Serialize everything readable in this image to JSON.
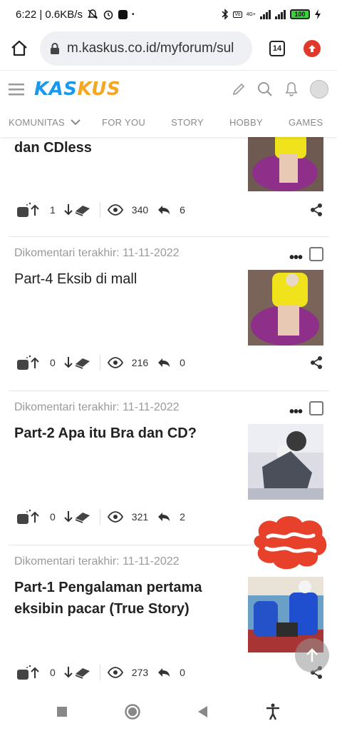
{
  "status": {
    "time_speed": "6:22 | 0.6KB/s",
    "battery": "100",
    "net": "4G+"
  },
  "browser": {
    "url": "m.kaskus.co.id/myforum/sul",
    "tab_count": "14",
    "icons": [
      "home-icon",
      "lock-icon",
      "tabs-icon",
      "upload-icon"
    ]
  },
  "site": {
    "logo_part1": "KAS",
    "logo_part2": "KUS",
    "brand_blue": "#1998ed",
    "brand_orange": "#f5a623"
  },
  "nav": {
    "tabs": [
      "KOMUNITAS",
      "FOR YOU",
      "STORY",
      "HOBBY",
      "GAMES"
    ]
  },
  "posts": [
    {
      "meta": "",
      "title": "dan CDless",
      "cendol": "1",
      "views": "340",
      "replies": "6"
    },
    {
      "meta": "Dikomentari terakhir: 11-11-2022",
      "title": "Part-4 Eksib di mall",
      "cendol": "0",
      "views": "216",
      "replies": "0"
    },
    {
      "meta": "Dikomentari terakhir: 11-11-2022",
      "title": "Part-2 Apa itu Bra dan CD?",
      "cendol": "0",
      "views": "321",
      "replies": "2"
    },
    {
      "meta": "Dikomentari terakhir: 11-11-2022",
      "title": "Part-1 Pengalaman pertama eksibin pacar (True Story)",
      "cendol": "0",
      "views": "273",
      "replies": "0"
    }
  ],
  "more_label": "•••"
}
